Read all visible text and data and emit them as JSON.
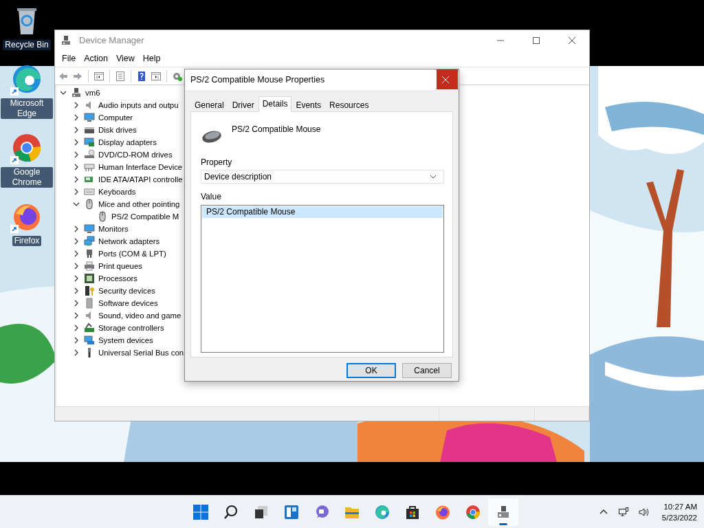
{
  "desktop_icons": [
    {
      "kind": "recycle",
      "label": "Recycle Bin",
      "shortcut": false
    },
    {
      "kind": "edge",
      "label": "Microsoft Edge",
      "shortcut": true
    },
    {
      "kind": "chrome",
      "label": "Google Chrome",
      "shortcut": true
    },
    {
      "kind": "firefox",
      "label": "Firefox",
      "shortcut": true
    }
  ],
  "device_manager": {
    "title": "Device Manager",
    "menu": [
      "File",
      "Action",
      "View",
      "Help"
    ],
    "tree": {
      "kind": "root",
      "label": "vm6",
      "expanded": true,
      "children": [
        {
          "kind": "audio",
          "label": "Audio inputs and outpu",
          "expanded": false
        },
        {
          "kind": "computer",
          "label": "Computer",
          "expanded": false
        },
        {
          "kind": "disk",
          "label": "Disk drives",
          "expanded": false
        },
        {
          "kind": "display",
          "label": "Display adapters",
          "expanded": false
        },
        {
          "kind": "dvd",
          "label": "DVD/CD-ROM drives",
          "expanded": false
        },
        {
          "kind": "hid",
          "label": "Human Interface Device",
          "expanded": false
        },
        {
          "kind": "ide",
          "label": "IDE ATA/ATAPI controlle",
          "expanded": false
        },
        {
          "kind": "keyboard",
          "label": "Keyboards",
          "expanded": false
        },
        {
          "kind": "mouse",
          "label": "Mice and other pointing",
          "expanded": true,
          "children": [
            {
              "kind": "mouse",
              "label": "PS/2 Compatible M"
            }
          ]
        },
        {
          "kind": "computer",
          "label": "Monitors",
          "expanded": false
        },
        {
          "kind": "network",
          "label": "Network adapters",
          "expanded": false
        },
        {
          "kind": "port",
          "label": "Ports (COM & LPT)",
          "expanded": false
        },
        {
          "kind": "printer",
          "label": "Print queues",
          "expanded": false
        },
        {
          "kind": "processor",
          "label": "Processors",
          "expanded": false
        },
        {
          "kind": "security",
          "label": "Security devices",
          "expanded": false
        },
        {
          "kind": "software",
          "label": "Software devices",
          "expanded": false
        },
        {
          "kind": "audio",
          "label": "Sound, video and game",
          "expanded": false
        },
        {
          "kind": "storage",
          "label": "Storage controllers",
          "expanded": false
        },
        {
          "kind": "system",
          "label": "System devices",
          "expanded": false
        },
        {
          "kind": "usb",
          "label": "Universal Serial Bus con",
          "expanded": false
        }
      ]
    }
  },
  "dialog": {
    "title": "PS/2 Compatible Mouse Properties",
    "close_hovered": true,
    "tabs": [
      {
        "label": "General",
        "selected": false
      },
      {
        "label": "Driver",
        "selected": false
      },
      {
        "label": "Details",
        "selected": true
      },
      {
        "label": "Events",
        "selected": false
      },
      {
        "label": "Resources",
        "selected": false
      }
    ],
    "device_name": "PS/2 Compatible Mouse",
    "property_label": "Property",
    "property_value": "Device description",
    "value_label": "Value",
    "values": [
      {
        "text": "PS/2 Compatible Mouse",
        "selected": true
      }
    ],
    "buttons": [
      {
        "label": "OK",
        "default": true
      },
      {
        "label": "Cancel",
        "default": false
      }
    ]
  },
  "taskbar": {
    "items": [
      {
        "kind": "start",
        "selected": false
      },
      {
        "kind": "search",
        "selected": false
      },
      {
        "kind": "taskview",
        "selected": false
      },
      {
        "kind": "widgets",
        "selected": false
      },
      {
        "kind": "chat",
        "selected": false
      },
      {
        "kind": "explorer",
        "selected": false
      },
      {
        "kind": "edge",
        "selected": false
      },
      {
        "kind": "store",
        "selected": false
      },
      {
        "kind": "firefox",
        "selected": false
      },
      {
        "kind": "chrome",
        "selected": false
      },
      {
        "kind": "devmgr",
        "selected": true
      }
    ],
    "time": "10:27 AM",
    "date": "5/23/2022"
  }
}
